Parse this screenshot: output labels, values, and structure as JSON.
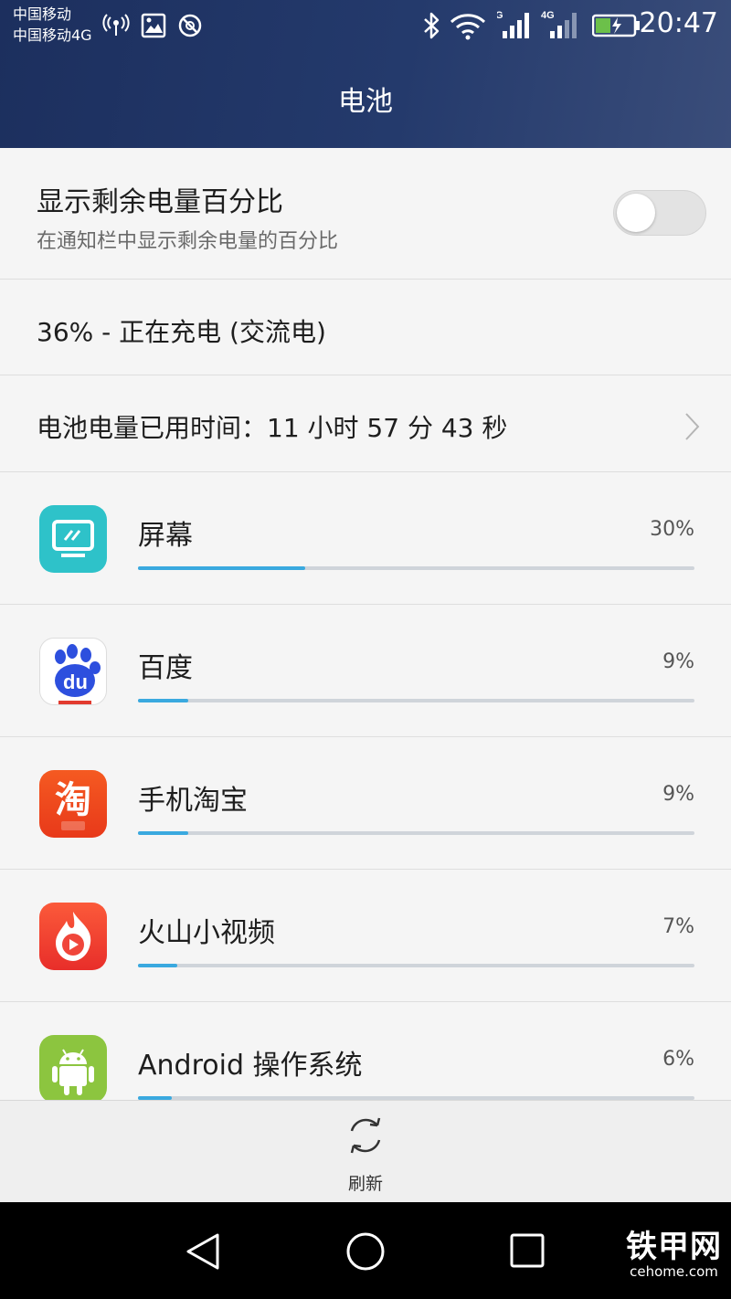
{
  "status_bar": {
    "carrier_1": "中国移动",
    "carrier_2": "中国移动4G",
    "network_label_1": "G",
    "network_label_2": "4G",
    "time": "20:47"
  },
  "header": {
    "title": "电池"
  },
  "settings": {
    "percentage_toggle": {
      "title": "显示剩余电量百分比",
      "subtitle": "在通知栏中显示剩余电量的百分比",
      "enabled": false
    },
    "charge_status": "36% - 正在充电 (交流电)",
    "usage_time": "电池电量已用时间：11 小时 57 分 43 秒"
  },
  "apps": [
    {
      "name": "屏幕",
      "percent_label": "30%",
      "percent": 30,
      "icon": "screen-icon"
    },
    {
      "name": "百度",
      "percent_label": "9%",
      "percent": 9,
      "icon": "baidu-icon"
    },
    {
      "name": "手机淘宝",
      "percent_label": "9%",
      "percent": 9,
      "icon": "taobao-icon"
    },
    {
      "name": "火山小视频",
      "percent_label": "7%",
      "percent": 7,
      "icon": "huoshan-icon"
    },
    {
      "name": "Android 操作系统",
      "percent_label": "6%",
      "percent": 6,
      "icon": "android-icon"
    }
  ],
  "footer": {
    "refresh_label": "刷新"
  },
  "watermark": {
    "main": "铁甲网",
    "sub": "cehome.com"
  },
  "colors": {
    "header_bg": "#1c2f5e",
    "bar_fill": "#3aa9df",
    "bar_track": "#cfd4da",
    "battery_fill": "#6cc04a"
  }
}
